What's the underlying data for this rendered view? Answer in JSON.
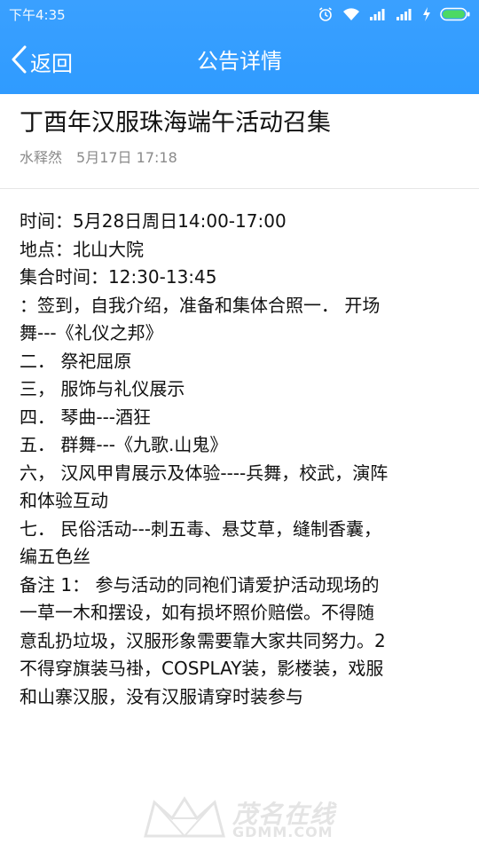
{
  "status": {
    "time": "下午4:35",
    "icons": [
      "alarm-icon",
      "wifi-icon",
      "signal-icon",
      "signal-icon",
      "charging-icon",
      "battery-icon"
    ]
  },
  "nav": {
    "back_label": "返回",
    "title": "公告详情"
  },
  "post": {
    "title": "丁酉年汉服珠海端午活动召集",
    "author": "水释然",
    "time": "5月17日 17:18"
  },
  "content": {
    "lines": [
      "时间：5月28日周日14:00-17:00",
      "地点：北山大院",
      "集合时间：12:30-13:45",
      "：签到，自我介绍，准备和集体合照一． 开场",
      "舞---《礼仪之邦》",
      "二．  祭祀屈原",
      "三，  服饰与礼仪展示",
      "四．  琴曲---酒狂",
      "五．  群舞---《九歌.山鬼》",
      "六，  汉风甲胄展示及体验----兵舞，校武，演阵",
      "和体验互动",
      "七．  民俗活动---刺五毒、悬艾草，缝制香囊，",
      "编五色丝",
      "备注 1：  参与活动的同袍们请爱护活动现场的",
      "一草一木和摆设，如有损坏照价赔偿。不得随",
      "意乱扔垃圾，汉服形象需要靠大家共同努力。2",
      "不得穿旗装马褂，COSPLAY装，影楼装，戏服",
      "和山寨汉服，没有汉服请穿时装参与"
    ]
  },
  "watermark": {
    "cn": "茂名在线",
    "en": "GDMM.COM"
  },
  "colors": {
    "accent": "#2f9bff",
    "meta_text": "#8a8a8a",
    "divider": "#e6e6e6",
    "battery": "#4cd964"
  }
}
